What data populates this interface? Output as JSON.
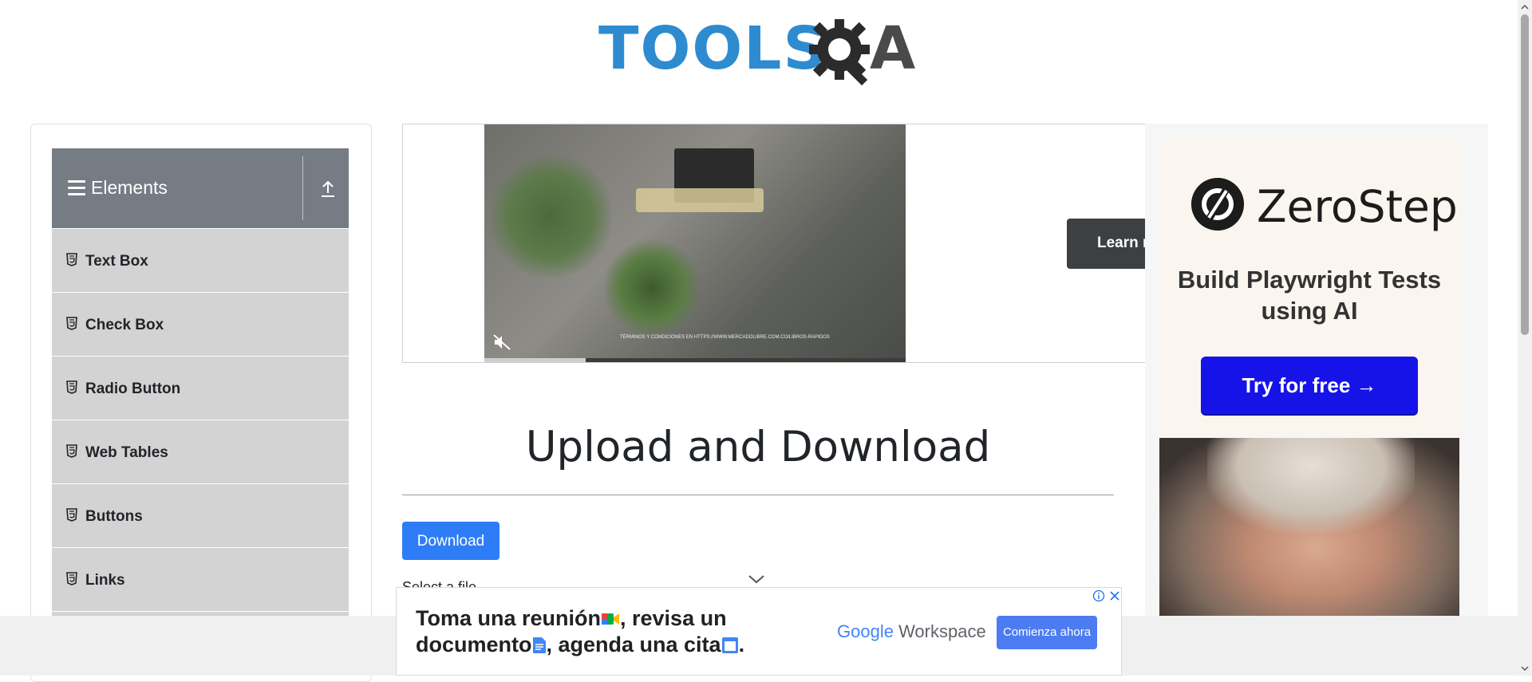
{
  "header": {
    "logo": {
      "part1": "TOOLS",
      "part2": "A",
      "brand_blue": "#2e8bcf",
      "brand_gray": "#4a4a4a"
    }
  },
  "sidebar": {
    "group_title": "Elements",
    "items": [
      {
        "label": "Text Box"
      },
      {
        "label": "Check Box"
      },
      {
        "label": "Radio Button"
      },
      {
        "label": "Web Tables"
      },
      {
        "label": "Buttons"
      },
      {
        "label": "Links"
      }
    ]
  },
  "ad_video": {
    "learn_more_label": "Learn more",
    "caption": "TÉRMINOS Y CONDICIONES EN HTTPS://WWW.MERCADOLIBRE.COM.CO/LIBROS-RAPIDOS"
  },
  "right_ad": {
    "brand": "ZeroStep",
    "tagline": "Build Playwright Tests using AI",
    "cta": "Try for free →",
    "cta_color": "#1613e8"
  },
  "main": {
    "title": "Upload and Download",
    "download_label": "Download",
    "select_label": "Select a file",
    "accent": "#2f7df6"
  },
  "bottom_ad": {
    "line1": "Toma una reunión",
    "line1b": ", revisa un",
    "line2": "documento",
    "line2b": ", agenda una cita",
    "line2c": ".",
    "brand_google": "Google",
    "brand_workspace": " Workspace",
    "cta": "Comienza ahora"
  }
}
